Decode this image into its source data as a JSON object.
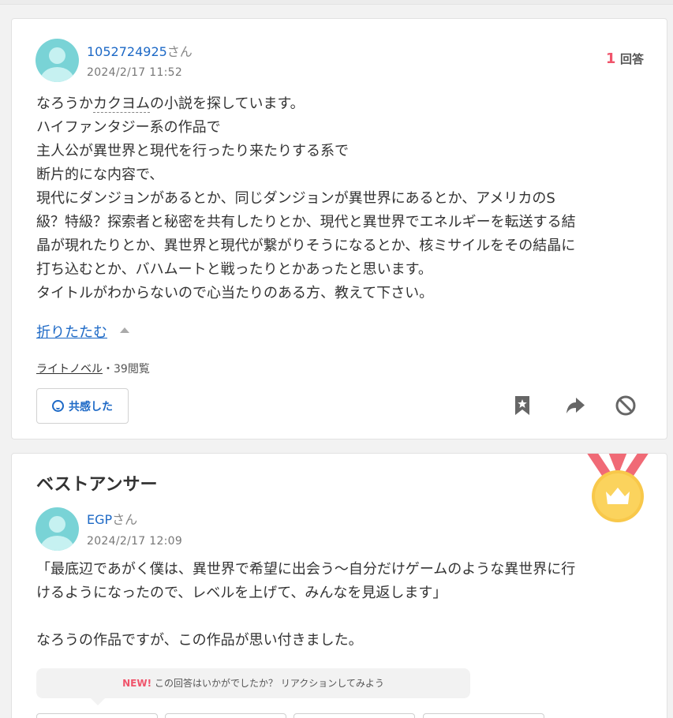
{
  "question": {
    "user_id": "1052724925",
    "user_suffix": "さん",
    "timestamp": "2024/2/17 11:52",
    "answer_count": "1",
    "answer_label": "回答",
    "body_line1_a": "なろうか",
    "body_line1_b": "カクヨム",
    "body_line1_c": "の小説を探しています。",
    "body_lines": [
      "ハイファンタジー系の作品で",
      "主人公が異世界と現代を行ったり来たりする系で",
      "断片的にな内容で、",
      "現代にダンジョンがあるとか、同じダンジョンが異世界にあるとか、アメリカのS",
      "級？特級？探索者と秘密を共有したりとか、現代と異世界でエネルギーを転送する結",
      "晶が現れたりとか、異世界と現代が繋がりそうになるとか、核ミサイルをその結晶に",
      "打ち込むとか、バハムートと戦ったりとかあったと思います。",
      "タイトルがわからないので心当たりのある方、教えて下さい。"
    ],
    "collapse_label": "折りたたむ",
    "category": "ライトノベル",
    "views": "・39閲覧",
    "empathy_label": "共感した"
  },
  "best_answer": {
    "title": "ベストアンサー",
    "user_id": "EGP",
    "user_suffix": "さん",
    "timestamp": "2024/2/17 12:09",
    "body_lines": [
      "「最底辺であがく僕は、異世界で希望に出会う〜自分だけゲームのような異世界に行",
      "けるようになったので、レベルを上げて、みんなを見返します」"
    ],
    "body_after": "なろうの作品ですが、この作品が思い付きました。",
    "reaction_new": "NEW!",
    "reaction_prompt": "この回答はいかがでしたか？ リアクションしてみよう"
  },
  "colors": {
    "accent_blue": "#1d69c6",
    "accent_red": "#f0546b",
    "avatar": "#79d3d6",
    "medal_gold": "#f8c84a",
    "ribbon": "#f06a76"
  },
  "icons": [
    "smile-icon",
    "bookmark-icon",
    "share-icon",
    "block-icon",
    "crown-medal-icon"
  ]
}
